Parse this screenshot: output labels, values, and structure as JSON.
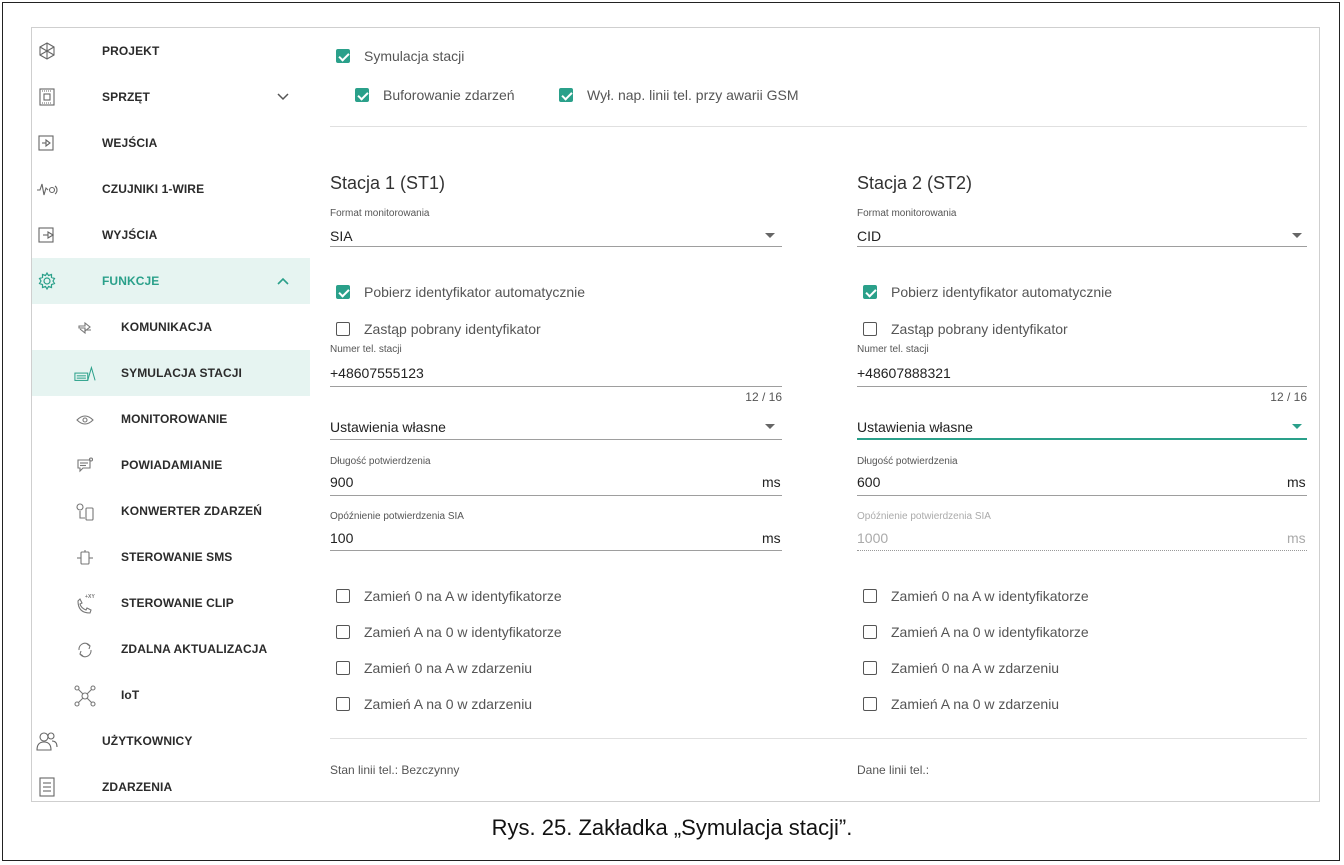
{
  "sidebar": {
    "items": [
      {
        "label": "PROJEKT",
        "icon": "project-icon"
      },
      {
        "label": "SPRZĘT",
        "icon": "hardware-icon"
      },
      {
        "label": "WEJŚCIA",
        "icon": "inputs-icon"
      },
      {
        "label": "CZUJNIKI 1-WIRE",
        "icon": "sensor-1wire-icon"
      },
      {
        "label": "WYJŚCIA",
        "icon": "outputs-icon"
      },
      {
        "label": "FUNKCJE",
        "icon": "functions-gear-icon"
      },
      {
        "label": "KOMUNIKACJA",
        "icon": "communication-icon"
      },
      {
        "label": "SYMULACJA STACJI",
        "icon": "station-simulation-icon"
      },
      {
        "label": "MONITOROWANIE",
        "icon": "monitoring-eye-icon"
      },
      {
        "label": "POWIADAMIANIE",
        "icon": "notification-icon"
      },
      {
        "label": "KONWERTER ZDARZEŃ",
        "icon": "event-converter-icon"
      },
      {
        "label": "STEROWANIE SMS",
        "icon": "sms-control-icon"
      },
      {
        "label": "STEROWANIE CLIP",
        "icon": "clip-control-icon"
      },
      {
        "label": "ZDALNA AKTUALIZACJA",
        "icon": "remote-update-icon"
      },
      {
        "label": "IoT",
        "icon": "iot-icon"
      },
      {
        "label": "UŻYTKOWNICY",
        "icon": "users-icon"
      },
      {
        "label": "ZDARZENIA",
        "icon": "events-icon"
      }
    ]
  },
  "top_options": {
    "station_simulation": {
      "label": "Symulacja stacji",
      "checked": true
    },
    "event_buffering": {
      "label": "Buforowanie zdarzeń",
      "checked": true
    },
    "gsm_line_off": {
      "label": "Wył. nap. linii tel. przy awarii GSM",
      "checked": true
    }
  },
  "stations": [
    {
      "title": "Stacja 1 (ST1)",
      "format_label": "Format monitorowania",
      "format_value": "SIA",
      "auto_id": {
        "label": "Pobierz identyfikator automatycznie",
        "checked": true
      },
      "replace_id": {
        "label": "Zastąp pobrany identyfikator",
        "checked": false
      },
      "phone_label": "Numer tel. stacji",
      "phone_value": "+48607555123",
      "phone_counter": "12 / 16",
      "settings_value": "Ustawienia własne",
      "ack_len_label": "Długość potwierdzenia",
      "ack_len_value": "900",
      "ack_len_unit": "ms",
      "sia_delay_label": "Opóźnienie potwierdzenia SIA",
      "sia_delay_value": "100",
      "sia_delay_unit": "ms",
      "sia_delay_disabled": false,
      "swaps": [
        {
          "label": "Zamień 0 na A w identyfikatorze",
          "checked": false
        },
        {
          "label": "Zamień A na 0 w identyfikatorze",
          "checked": false
        },
        {
          "label": "Zamień 0 na A w zdarzeniu",
          "checked": false
        },
        {
          "label": "Zamień A na 0 w zdarzeniu",
          "checked": false
        }
      ],
      "status": "Stan linii tel.: Bezczynny"
    },
    {
      "title": "Stacja 2 (ST2)",
      "format_label": "Format monitorowania",
      "format_value": "CID",
      "auto_id": {
        "label": "Pobierz identyfikator automatycznie",
        "checked": true
      },
      "replace_id": {
        "label": "Zastąp pobrany identyfikator",
        "checked": false
      },
      "phone_label": "Numer tel. stacji",
      "phone_value": "+48607888321",
      "phone_counter": "12 / 16",
      "settings_value": "Ustawienia własne",
      "ack_len_label": "Długość potwierdzenia",
      "ack_len_value": "600",
      "ack_len_unit": "ms",
      "sia_delay_label": "Opóźnienie potwierdzenia SIA",
      "sia_delay_value": "1000",
      "sia_delay_unit": "ms",
      "sia_delay_disabled": true,
      "swaps": [
        {
          "label": "Zamień 0 na A w identyfikatorze",
          "checked": false
        },
        {
          "label": "Zamień A na 0 w identyfikatorze",
          "checked": false
        },
        {
          "label": "Zamień 0 na A w zdarzeniu",
          "checked": false
        },
        {
          "label": "Zamień A na 0 w zdarzeniu",
          "checked": false
        }
      ],
      "status": "Dane linii tel.:"
    }
  ],
  "caption": "Rys. 25. Zakładka „Symulacja stacji”.",
  "colors": {
    "accent": "#2aa08a",
    "active_bg": "#e6f4f1"
  }
}
